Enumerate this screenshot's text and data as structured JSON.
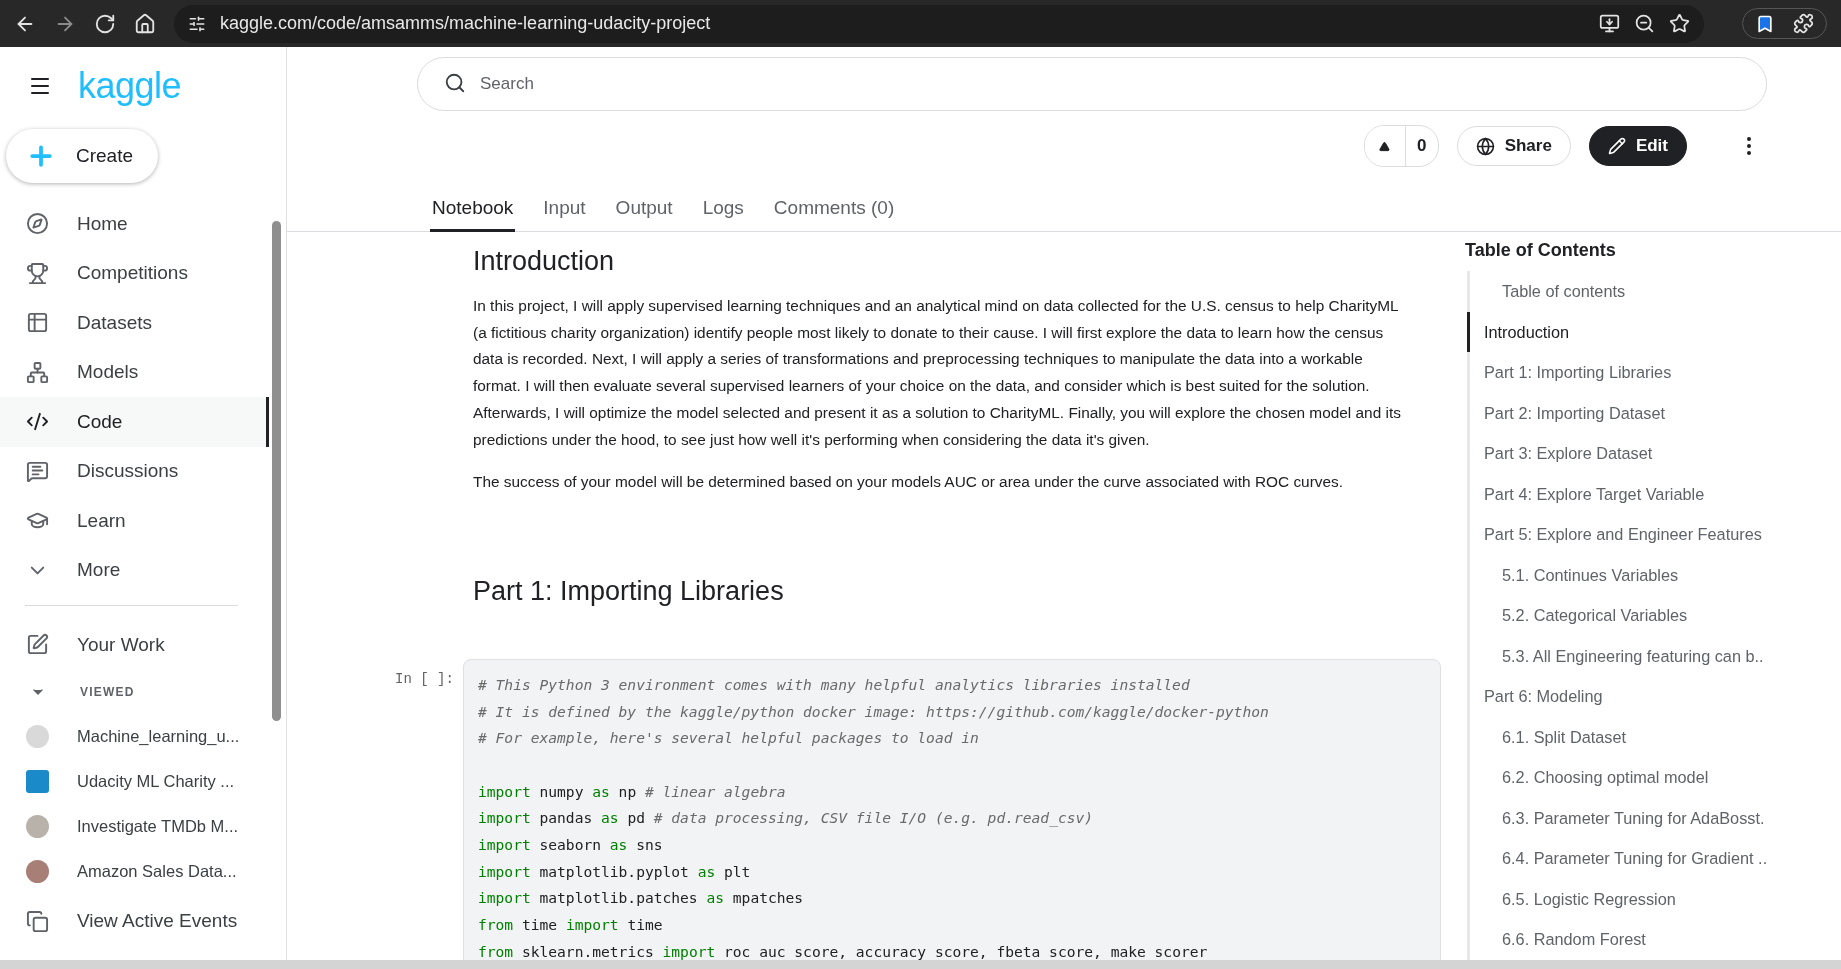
{
  "browser": {
    "url": "kaggle.com/code/amsamms/machine-learning-udacity-project"
  },
  "brand": "kaggle",
  "create_button": "Create",
  "nav": [
    {
      "label": "Home",
      "selected": false
    },
    {
      "label": "Competitions",
      "selected": false
    },
    {
      "label": "Datasets",
      "selected": false
    },
    {
      "label": "Models",
      "selected": false
    },
    {
      "label": "Code",
      "selected": true
    },
    {
      "label": "Discussions",
      "selected": false
    },
    {
      "label": "Learn",
      "selected": false
    },
    {
      "label": "More",
      "selected": false
    }
  ],
  "your_work": "Your Work",
  "viewed_heading": "VIEWED",
  "viewed": [
    {
      "label": "Machine_learning_u...",
      "color": "#d9d9d9"
    },
    {
      "label": "Udacity ML Charity ...",
      "color": "#1a8ac9"
    },
    {
      "label": "Investigate TMDb M...",
      "color": "#b9b2aa"
    },
    {
      "label": "Amazon Sales Data...",
      "color": "#a87f76"
    }
  ],
  "view_events": "View Active Events",
  "search": {
    "placeholder": "Search"
  },
  "vote": {
    "count": "0"
  },
  "share_button": "Share",
  "edit_button": "Edit",
  "tabs": [
    {
      "label": "Notebook",
      "selected": true
    },
    {
      "label": "Input",
      "selected": false
    },
    {
      "label": "Output",
      "selected": false
    },
    {
      "label": "Logs",
      "selected": false
    },
    {
      "label": "Comments (0)",
      "selected": false
    }
  ],
  "intro": {
    "heading": "Introduction",
    "paragraphs": [
      "In this project, I will apply supervised learning techniques and an analytical mind on data collected for the U.S. census to help CharityML (a fictitious charity organization) identify people most likely to donate to their cause. I will first explore the data to learn how the census data is recorded. Next, I will apply a series of transformations and preprocessing techniques to manipulate the data into a workable format. I will then evaluate several supervised learners of your choice on the data, and consider which is best suited for the solution. Afterwards, I will optimize the model selected and present it as a solution to CharityML. Finally, you will explore the chosen model and its predictions under the hood, to see just how well it's performing when considering the data it's given.",
      "The success of your model will be determined based on your models AUC or area under the curve associated with ROC curves."
    ]
  },
  "part1_heading": "Part 1: Importing Libraries",
  "cell": {
    "prompt": "In [ ]:",
    "lines": [
      [
        {
          "kind": "comment",
          "text": "# This Python 3 environment comes with many helpful analytics libraries installed"
        }
      ],
      [
        {
          "kind": "comment",
          "text": "# It is defined by the kaggle/python docker image: https://github.com/kaggle/docker-python"
        }
      ],
      [
        {
          "kind": "comment",
          "text": "# For example, here's several helpful packages to load in"
        }
      ],
      [
        {
          "kind": "blank"
        }
      ],
      [
        {
          "kind": "keyword",
          "text": "import"
        },
        {
          "kind": "plain",
          "text": " numpy "
        },
        {
          "kind": "keyword",
          "text": "as"
        },
        {
          "kind": "plain",
          "text": " np "
        },
        {
          "kind": "comment",
          "text": "# linear algebra"
        }
      ],
      [
        {
          "kind": "keyword",
          "text": "import"
        },
        {
          "kind": "plain",
          "text": " pandas "
        },
        {
          "kind": "keyword",
          "text": "as"
        },
        {
          "kind": "plain",
          "text": " pd "
        },
        {
          "kind": "comment",
          "text": "# data processing, CSV file I/O (e.g. pd.read_csv)"
        }
      ],
      [
        {
          "kind": "keyword",
          "text": "import"
        },
        {
          "kind": "plain",
          "text": " seaborn "
        },
        {
          "kind": "keyword",
          "text": "as"
        },
        {
          "kind": "plain",
          "text": " sns"
        }
      ],
      [
        {
          "kind": "keyword",
          "text": "import"
        },
        {
          "kind": "plain",
          "text": " matplotlib.pyplot "
        },
        {
          "kind": "keyword",
          "text": "as"
        },
        {
          "kind": "plain",
          "text": " plt"
        }
      ],
      [
        {
          "kind": "keyword",
          "text": "import"
        },
        {
          "kind": "plain",
          "text": " matplotlib.patches "
        },
        {
          "kind": "keyword",
          "text": "as"
        },
        {
          "kind": "plain",
          "text": " mpatches"
        }
      ],
      [
        {
          "kind": "keyword",
          "text": "from"
        },
        {
          "kind": "plain",
          "text": " time "
        },
        {
          "kind": "keyword",
          "text": "import"
        },
        {
          "kind": "plain",
          "text": " time"
        }
      ],
      [
        {
          "kind": "keyword",
          "text": "from"
        },
        {
          "kind": "plain",
          "text": " sklearn.metrics "
        },
        {
          "kind": "keyword",
          "text": "import"
        },
        {
          "kind": "plain",
          "text": " roc_auc_score, accuracy_score, fbeta_score, make_scorer"
        }
      ]
    ]
  },
  "toc": {
    "title": "Table of Contents",
    "items": [
      {
        "label": "Table of contents",
        "selected": false,
        "kind": "sub"
      },
      {
        "label": "Introduction",
        "selected": true
      },
      {
        "label": "Part 1: Importing Libraries",
        "selected": false
      },
      {
        "label": "Part 2: Importing Dataset",
        "selected": false
      },
      {
        "label": "Part 3: Explore Dataset",
        "selected": false
      },
      {
        "label": "Part 4: Explore Target Variable",
        "selected": false
      },
      {
        "label": "Part 5: Explore and Engineer Features",
        "selected": false,
        "children": [
          {
            "label": "5.1. Continues Variables",
            "selected": false
          },
          {
            "label": "5.2. Categorical Variables",
            "selected": false
          },
          {
            "label": "5.3. All Engineering featuring can b..",
            "selected": false
          }
        ]
      },
      {
        "label": "Part 6: Modeling",
        "selected": false,
        "children": [
          {
            "label": "6.1. Split Dataset",
            "selected": false
          },
          {
            "label": "6.2. Choosing optimal model",
            "selected": false
          },
          {
            "label": "6.3. Parameter Tuning for AdaBosst.",
            "selected": false
          },
          {
            "label": "6.4. Parameter Tuning for Gradient ..",
            "selected": false
          },
          {
            "label": "6.5. Logistic Regression",
            "selected": false
          },
          {
            "label": "6.6. Random Forest",
            "selected": false
          }
        ]
      }
    ]
  }
}
